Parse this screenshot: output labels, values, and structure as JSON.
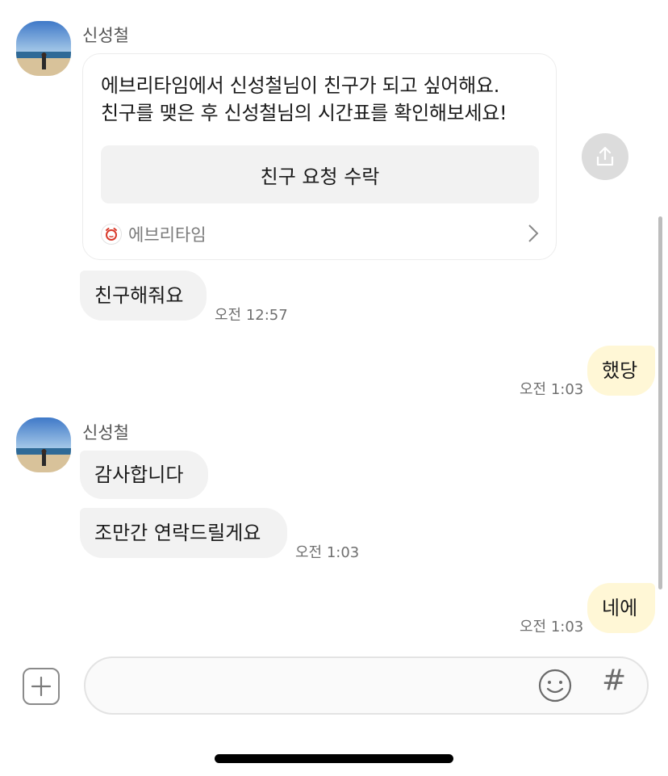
{
  "conversation": {
    "sender_name": "신성철",
    "card": {
      "line1": "에브리타임에서 신성철님이 친구가 되고 싶어해요.",
      "line2": "친구를 맺은 후 신성철님의 시간표를 확인해보세요!",
      "button_label": "친구 요청 수락",
      "app_name": "에브리타임"
    },
    "messages": [
      {
        "text": "친구해줘요",
        "time": "오전 12:57"
      },
      {
        "text": "했당",
        "time": "오전 1:03"
      },
      {
        "text": "감사합니다"
      },
      {
        "text": "조만간 연락드릴게요",
        "time": "오전 1:03"
      },
      {
        "text": "네에",
        "time": "오전 1:03"
      }
    ]
  },
  "composer": {
    "input_value": "",
    "hash_symbol": "#"
  },
  "icons": {
    "plus": "plus-icon",
    "emoji": "emoji-icon",
    "share": "share-icon",
    "chevron": "chevron-right-icon",
    "app": "alarm-clock-icon"
  },
  "colors": {
    "outgoing_bubble": "#fff7d6",
    "incoming_bubble": "#f2f2f2",
    "app_icon_red": "#d93a2b"
  }
}
